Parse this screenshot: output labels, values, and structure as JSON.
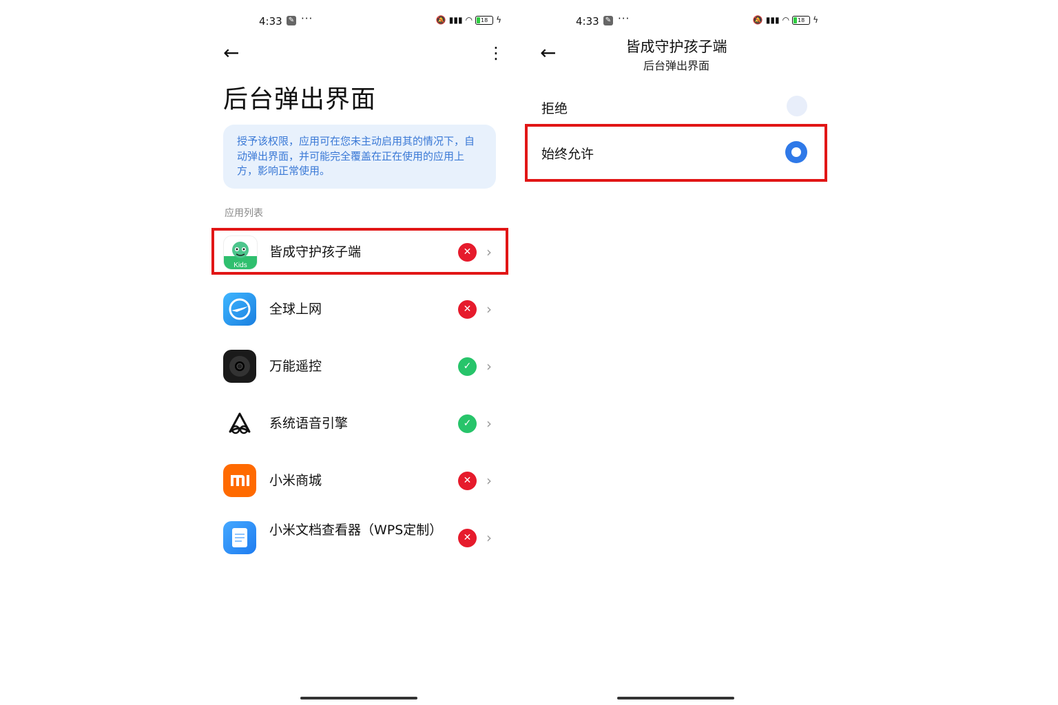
{
  "status_bar": {
    "time": "4:33",
    "battery": "18"
  },
  "left_screen": {
    "title": "后台弹出界面",
    "info_text": "授予该权限，应用可在您未主动启用其的情况下，自动弹出界面，并可能完全覆盖在正在使用的应用上方，影响正常使用。",
    "section_label": "应用列表",
    "apps": [
      {
        "name": "皆成守护孩子端",
        "allowed": false,
        "icon": "kids-app-icon"
      },
      {
        "name": "全球上网",
        "allowed": false,
        "icon": "plane-globe-icon"
      },
      {
        "name": "万能遥控",
        "allowed": true,
        "icon": "remote-control-icon"
      },
      {
        "name": "系统语音引擎",
        "allowed": true,
        "icon": "voice-engine-icon"
      },
      {
        "name": "小米商城",
        "allowed": false,
        "icon": "mi-store-icon"
      },
      {
        "name": "小米文档查看器（WPS定制）",
        "allowed": false,
        "icon": "document-viewer-icon"
      }
    ],
    "colors": {
      "denied": "#e61b2c",
      "allowed": "#27c46a",
      "highlight": "#e11616"
    }
  },
  "right_screen": {
    "title": "皆成守护孩子端",
    "subtitle": "后台弹出界面",
    "options": [
      {
        "label": "拒绝",
        "selected": false
      },
      {
        "label": "始终允许",
        "selected": true
      }
    ],
    "accent": "#2f79e8"
  }
}
